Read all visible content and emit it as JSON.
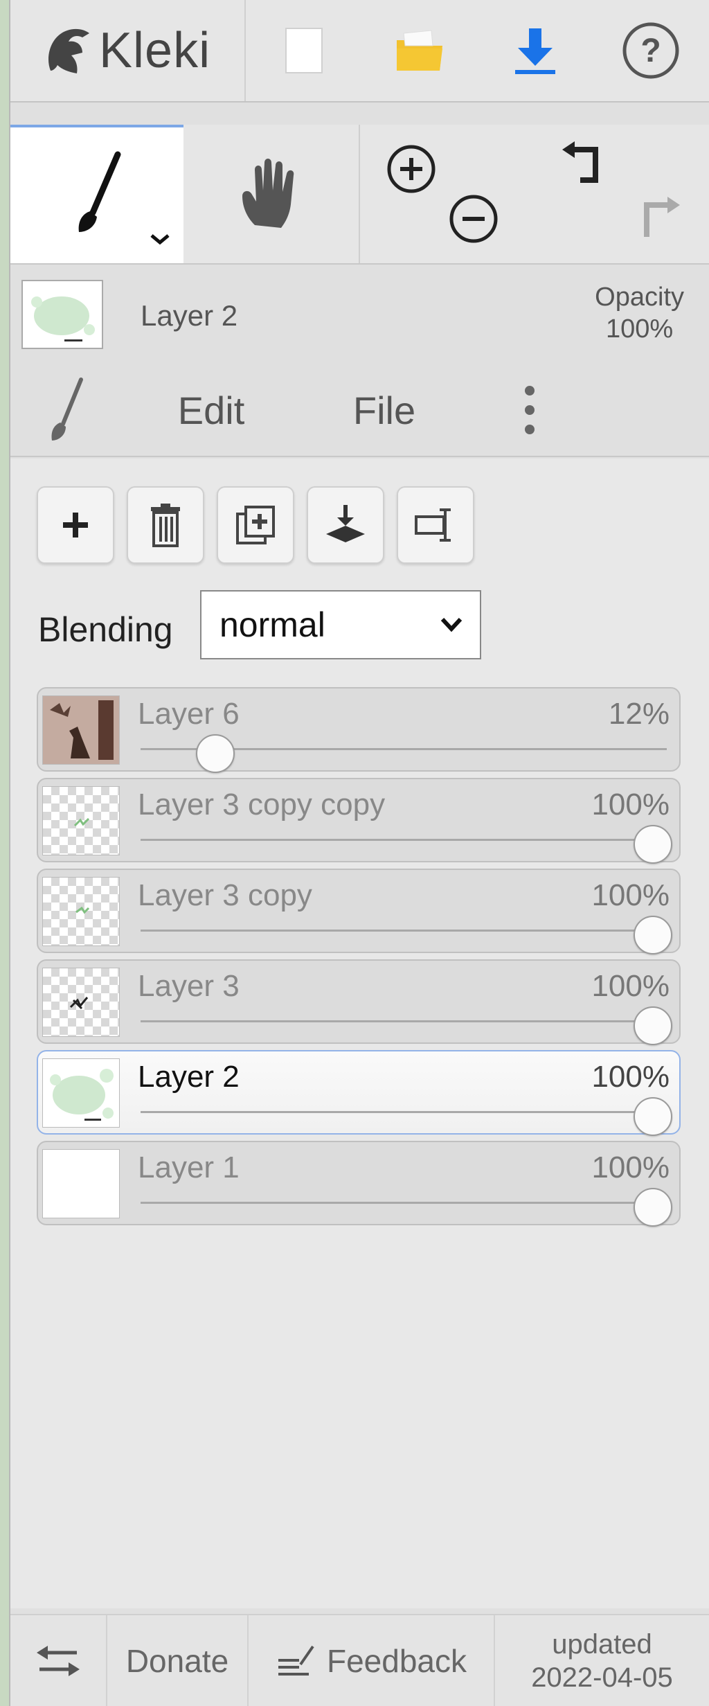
{
  "app": {
    "name": "Kleki"
  },
  "topbar": {
    "icons": [
      "kleki-logo-icon",
      "new-document-icon",
      "open-folder-icon",
      "download-icon",
      "help-icon"
    ]
  },
  "tools": {
    "brush": "brush-icon",
    "hand": "hand-icon",
    "zoom_in": "zoom-in-icon",
    "zoom_out": "zoom-out-icon",
    "undo": "undo-icon",
    "redo": "redo-icon"
  },
  "current_layer": {
    "name": "Layer 2",
    "opacity_label": "Opacity",
    "opacity_value": "100%"
  },
  "tabs": {
    "edit": "Edit",
    "file": "File"
  },
  "layer_actions": [
    "add-layer",
    "delete-layer",
    "duplicate-layer",
    "merge-down",
    "rename-layer"
  ],
  "blending": {
    "label": "Blending",
    "value": "normal"
  },
  "layers": [
    {
      "name": "Layer 6",
      "opacity": "12%",
      "opacity_fraction": 0.12,
      "active": false
    },
    {
      "name": "Layer 3 copy copy",
      "opacity": "100%",
      "opacity_fraction": 1.0,
      "active": false
    },
    {
      "name": "Layer 3 copy",
      "opacity": "100%",
      "opacity_fraction": 1.0,
      "active": false
    },
    {
      "name": "Layer 3",
      "opacity": "100%",
      "opacity_fraction": 1.0,
      "active": false
    },
    {
      "name": "Layer 2",
      "opacity": "100%",
      "opacity_fraction": 1.0,
      "active": true
    },
    {
      "name": "Layer 1",
      "opacity": "100%",
      "opacity_fraction": 1.0,
      "active": false
    }
  ],
  "bottombar": {
    "donate": "Donate",
    "feedback": "Feedback",
    "updated_label": "updated",
    "updated_date": "2022-04-05"
  },
  "colors": {
    "accent": "#7da7e6",
    "download": "#1a73e8",
    "folder": "#f2c12e"
  }
}
